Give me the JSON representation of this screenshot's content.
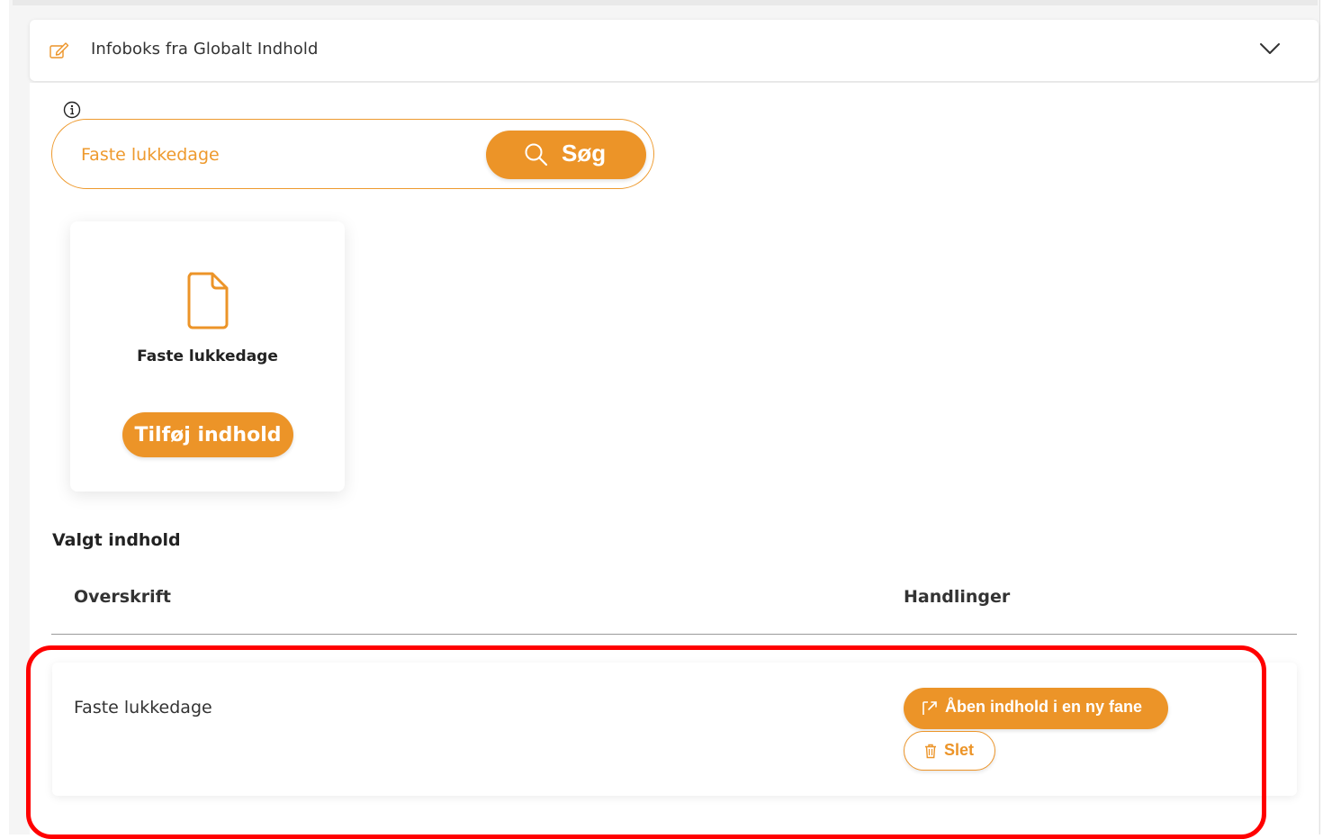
{
  "accordion": {
    "title": "Infoboks fra Globalt Indhold",
    "edit_icon": "edit-icon",
    "toggle_icon": "chevron-down-icon"
  },
  "search": {
    "info_icon": "info-icon",
    "value": "Faste lukkedage",
    "button_label": "Søg",
    "button_icon": "search-icon"
  },
  "result_card": {
    "icon": "document-icon",
    "title": "Faste lukkedage",
    "add_button": "Tilføj indhold"
  },
  "selected": {
    "section_title": "Valgt indhold",
    "columns": [
      "Overskrift",
      "Handlinger"
    ],
    "rows": [
      {
        "title": "Faste lukkedage",
        "open_button": "Åben indhold i en ny fane",
        "open_icon": "external-link-icon",
        "delete_button": "Slet",
        "delete_icon": "trash-icon"
      }
    ]
  },
  "colors": {
    "accent": "#ec9428",
    "highlight": "#ff0000",
    "text": "#333333"
  }
}
